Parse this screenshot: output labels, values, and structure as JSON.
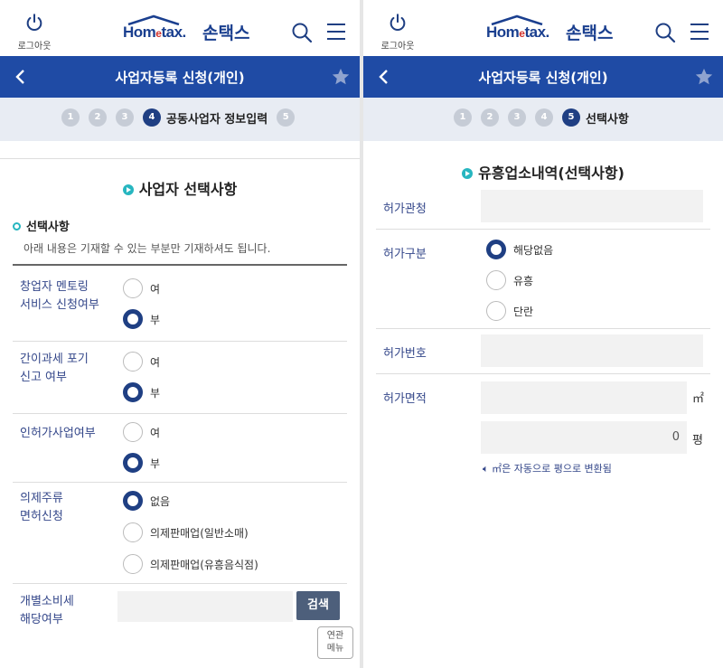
{
  "header": {
    "logout_label": "로그아웃",
    "logo_brand": "Hom",
    "logo_brand_e": "e",
    "logo_brand_tail": "tax.",
    "logo_korean": "손택스",
    "title": "사업자등록 신청(개인)"
  },
  "left": {
    "steps": [
      "1",
      "2",
      "3",
      "4",
      "5"
    ],
    "active_step": "4",
    "active_step_label": "공동사업자 정보입력",
    "section_title": "사업자 선택사항",
    "subhead": "선택사항",
    "note": "아래 내용은 기재할 수 있는 부분만 기재하셔도 됩니다.",
    "rows": [
      {
        "label_line1": "창업자 멘토링",
        "label_line2": "서비스 신청여부",
        "options": [
          "여",
          "부"
        ],
        "selected": 1
      },
      {
        "label_line1": "간이과세 포기",
        "label_line2": "신고 여부",
        "options": [
          "여",
          "부"
        ],
        "selected": 1
      },
      {
        "label_line1": "인허가사업여부",
        "label_line2": "",
        "options": [
          "여",
          "부"
        ],
        "selected": 1
      },
      {
        "label_line1": "의제주류",
        "label_line2": "면허신청",
        "options": [
          "없음",
          "의제판매업(일반소매)",
          "의제판매업(유흥음식점)"
        ],
        "selected": 0
      }
    ],
    "excise": {
      "label_line1": "개별소비세",
      "label_line2": "해당여부",
      "search_label": "검색",
      "value": ""
    },
    "related_line1": "연관",
    "related_line2": "메뉴"
  },
  "right": {
    "steps": [
      "1",
      "2",
      "3",
      "4",
      "5"
    ],
    "active_step": "5",
    "active_step_label": "선택사항",
    "section_title": "유흥업소내역(선택사항)",
    "permit_office": {
      "label": "허가관청",
      "value": ""
    },
    "permit_type": {
      "label": "허가구분",
      "options": [
        "해당없음",
        "유흥",
        "단란"
      ],
      "selected": 0
    },
    "permit_number": {
      "label": "허가번호",
      "value": ""
    },
    "permit_area": {
      "label": "허가면적",
      "unit_sqm": "㎡",
      "pyeong_value": "0",
      "unit_pyeong": "평",
      "hint": "㎡은 자동으로 평으로 변환됨"
    }
  },
  "colors": {
    "navy": "#1f4ba5",
    "accent_teal": "#27b6c0",
    "radio_on": "#1f3f83"
  }
}
